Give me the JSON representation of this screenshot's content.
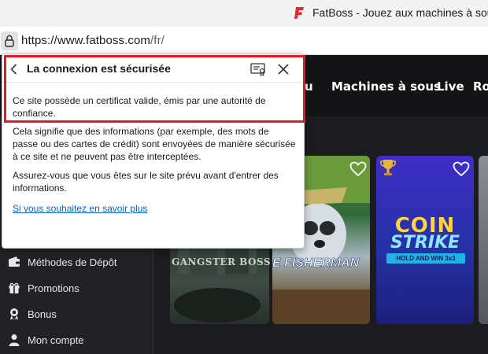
{
  "browser": {
    "tab_title": "FatBoss - Jouez aux machines à sous",
    "url_host": "https://www.fatboss.com",
    "url_rest": "/fr/"
  },
  "site_nav": {
    "items": [
      {
        "label": "u"
      },
      {
        "label": "Machines à sous"
      },
      {
        "label": "Live"
      },
      {
        "label": "Ro"
      }
    ]
  },
  "sidebar": {
    "items": [
      {
        "label": "Méthodes de Dépôt",
        "icon": "wallet-icon"
      },
      {
        "label": "Promotions",
        "icon": "gift-icon"
      },
      {
        "label": "Bonus",
        "icon": "medal-icon"
      },
      {
        "label": "Mon compte",
        "icon": "user-icon"
      }
    ]
  },
  "games": [
    {
      "title": "GANGSTER BOSS"
    },
    {
      "title": "E FISHERMAN"
    },
    {
      "title_line1": "COIN",
      "title_line2": "STRIKE",
      "badge": "HOLD AND WIN 3x3"
    }
  ],
  "security_popup": {
    "title": "La connexion est sécurisée",
    "cert_text": "Ce site possède un certificat valide, émis par une autorité de confiance.",
    "explanation": "Cela signifie que des informations (par exemple, des mots de passe ou des cartes de crédit) sont envoyées de manière sécurisée à ce site et ne peuvent pas être interceptées.",
    "advice": "Assurez-vous que vous êtes sur le site prévu avant d'entrer des informations.",
    "learn_more": "Si vous souhaitez en savoir plus"
  },
  "colors": {
    "highlight": "#e01b22",
    "link": "#0062c4",
    "brand_red": "#e5292b",
    "nav_bg": "#141417"
  }
}
